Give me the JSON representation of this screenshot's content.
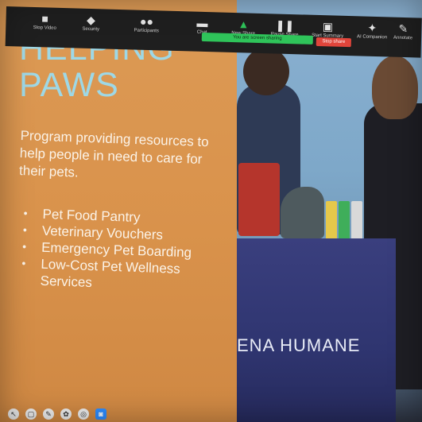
{
  "toolbar": {
    "stop_video": {
      "label": "Stop Video",
      "icon": "video-camera-icon"
    },
    "security": {
      "label": "Security",
      "icon": "shield-icon"
    },
    "participants": {
      "label": "Participants",
      "icon": "participants-icon"
    },
    "chat": {
      "label": "Chat",
      "icon": "chat-icon"
    },
    "new_share": {
      "label": "New Share",
      "icon": "share-screen-icon"
    },
    "pause_share": {
      "label": "Pause Share",
      "icon": "pause-icon"
    },
    "start_summary": {
      "label": "Start Summary",
      "icon": "summary-icon"
    },
    "ai_companion": {
      "label": "AI Companion",
      "icon": "sparkle-icon"
    },
    "annotate": {
      "label": "Annotate",
      "icon": "pencil-icon"
    },
    "sharing_status": "You are screen sharing",
    "stop_share": "Stop share"
  },
  "slide": {
    "title": "HELPING\nPAWS",
    "description": "Program providing resources to help people in need to care for their pets.",
    "bullets": [
      "Pet Food Pantry",
      "Veterinary Vouchers",
      "Emergency Pet Boarding",
      "Low-Cost Pet Wellness Services"
    ],
    "photo_banner": "ENA HUMANE",
    "colors": {
      "background": "#d9924b",
      "title": "#9ed8e6",
      "text": "#fbf3e8"
    }
  },
  "annotation_tools": [
    {
      "icon": "mouse-pointer-icon"
    },
    {
      "icon": "select-icon"
    },
    {
      "icon": "draw-icon"
    },
    {
      "icon": "stamp-icon"
    },
    {
      "icon": "spotlight-icon"
    },
    {
      "icon": "camera-icon"
    }
  ],
  "colors": {
    "toolbar": "#1f1f1f",
    "sharing_green": "#2fc45a",
    "stop_red": "#e0453b",
    "accent": "#2d8cff"
  }
}
